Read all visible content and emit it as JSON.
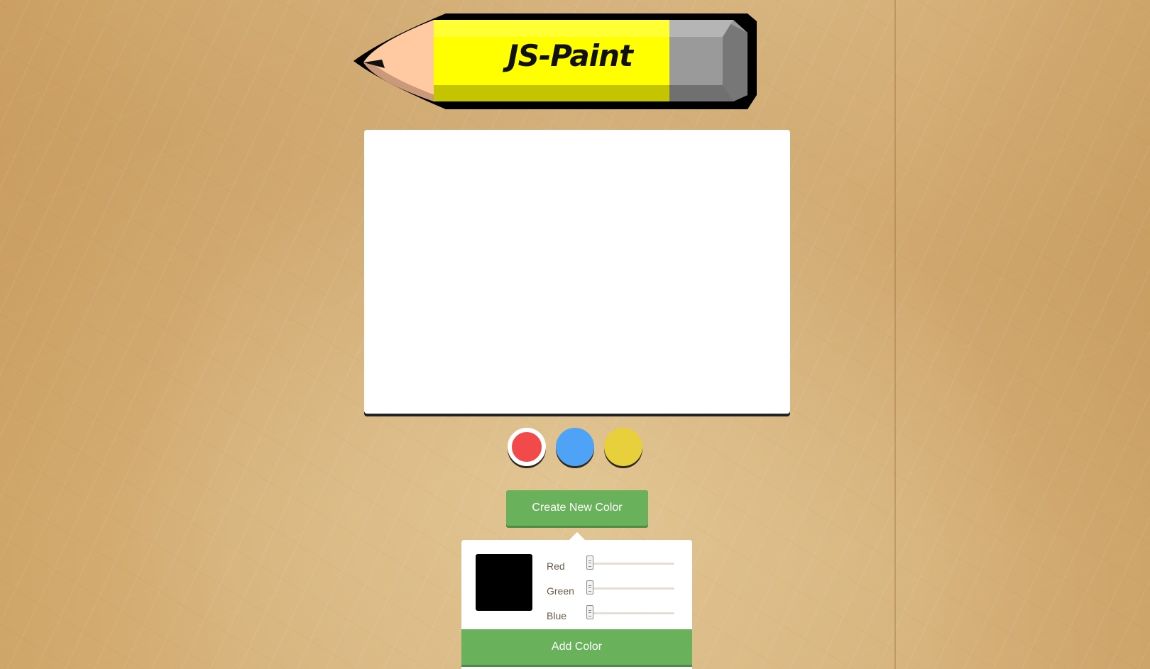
{
  "app": {
    "logo_text": "JS-Paint"
  },
  "swatches": [
    {
      "color": "#f24a4a",
      "selected": true
    },
    {
      "color": "#4fa3f7",
      "selected": false
    },
    {
      "color": "#e8cf3c",
      "selected": false
    }
  ],
  "create_button": {
    "label": "Create New Color"
  },
  "color_picker": {
    "preview_color": "#000000",
    "sliders": [
      {
        "label": "Red",
        "value": 0
      },
      {
        "label": "Green",
        "value": 0
      },
      {
        "label": "Blue",
        "value": 0
      }
    ],
    "add_button_label": "Add Color"
  },
  "colors": {
    "button_green": "#6ab15c",
    "pencil_yellow": "#ffff00",
    "canvas": "#ffffff"
  }
}
